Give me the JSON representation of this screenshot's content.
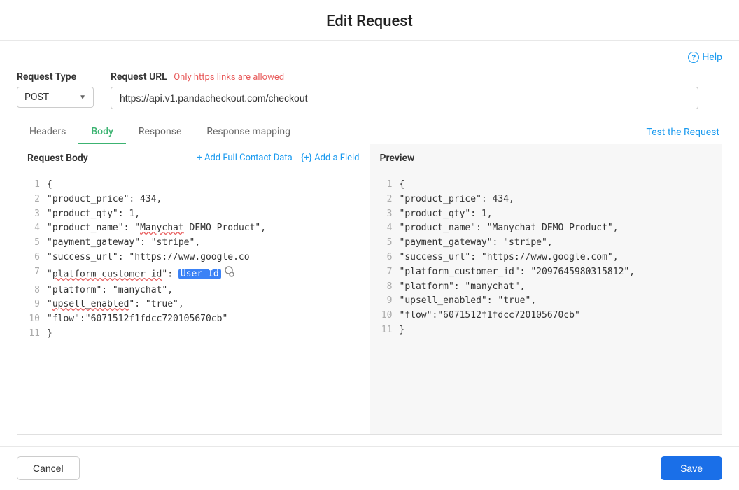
{
  "page": {
    "title": "Edit Request"
  },
  "help": {
    "label": "Help"
  },
  "request_type": {
    "label": "Request Type",
    "value": "POST"
  },
  "request_url": {
    "label": "Request URL",
    "note": "Only https links are allowed",
    "value": "https://api.v1.pandacheckout.com/checkout"
  },
  "tabs": [
    {
      "id": "headers",
      "label": "Headers",
      "active": false
    },
    {
      "id": "body",
      "label": "Body",
      "active": true
    },
    {
      "id": "response",
      "label": "Response",
      "active": false
    },
    {
      "id": "response-mapping",
      "label": "Response mapping",
      "active": false
    }
  ],
  "test_request": {
    "label": "Test the Request"
  },
  "editor": {
    "title": "Request Body",
    "add_full_contact": "+ Add Full Contact Data",
    "add_field": "{+} Add a Field",
    "lines": [
      {
        "num": 1,
        "content": "{"
      },
      {
        "num": 2,
        "content": "\"product_price\": 434,"
      },
      {
        "num": 3,
        "content": "\"product_qty\": 1,"
      },
      {
        "num": 4,
        "content": "\"product_name\": \"Manychat DEMO Product\","
      },
      {
        "num": 5,
        "content": "\"payment_gateway\": \"stripe\","
      },
      {
        "num": 6,
        "content": "\"success_url\": \"https://www.google.co"
      },
      {
        "num": 7,
        "content": "\"platform_customer_id\": ",
        "highlight": "User Id",
        "after": ","
      },
      {
        "num": 8,
        "content": "\"platform\": \"manychat\","
      },
      {
        "num": 9,
        "content": "\"upsell_enabled\": \"true\","
      },
      {
        "num": 10,
        "content": "\"flow\":\"6071512f1fdcc720105670cb\""
      },
      {
        "num": 11,
        "content": "}"
      }
    ]
  },
  "preview": {
    "title": "Preview",
    "lines": [
      {
        "num": 1,
        "content": "{"
      },
      {
        "num": 2,
        "content": "\"product_price\": 434,"
      },
      {
        "num": 3,
        "content": "\"product_qty\": 1,"
      },
      {
        "num": 4,
        "content": "\"product_name\": \"Manychat DEMO Product\","
      },
      {
        "num": 5,
        "content": "\"payment_gateway\": \"stripe\","
      },
      {
        "num": 6,
        "content": "\"success_url\": \"https://www.google.com\","
      },
      {
        "num": 7,
        "content": "\"platform_customer_id\": \"20976459803158 12\","
      },
      {
        "num": 8,
        "content": "\"platform\": \"manychat\","
      },
      {
        "num": 9,
        "content": "\"upsell_enabled\": \"true\","
      },
      {
        "num": 10,
        "content": "\"flow\":\"6071512f1fdcc720105670cb\""
      },
      {
        "num": 11,
        "content": "}"
      }
    ]
  },
  "footer": {
    "cancel_label": "Cancel",
    "save_label": "Save"
  }
}
